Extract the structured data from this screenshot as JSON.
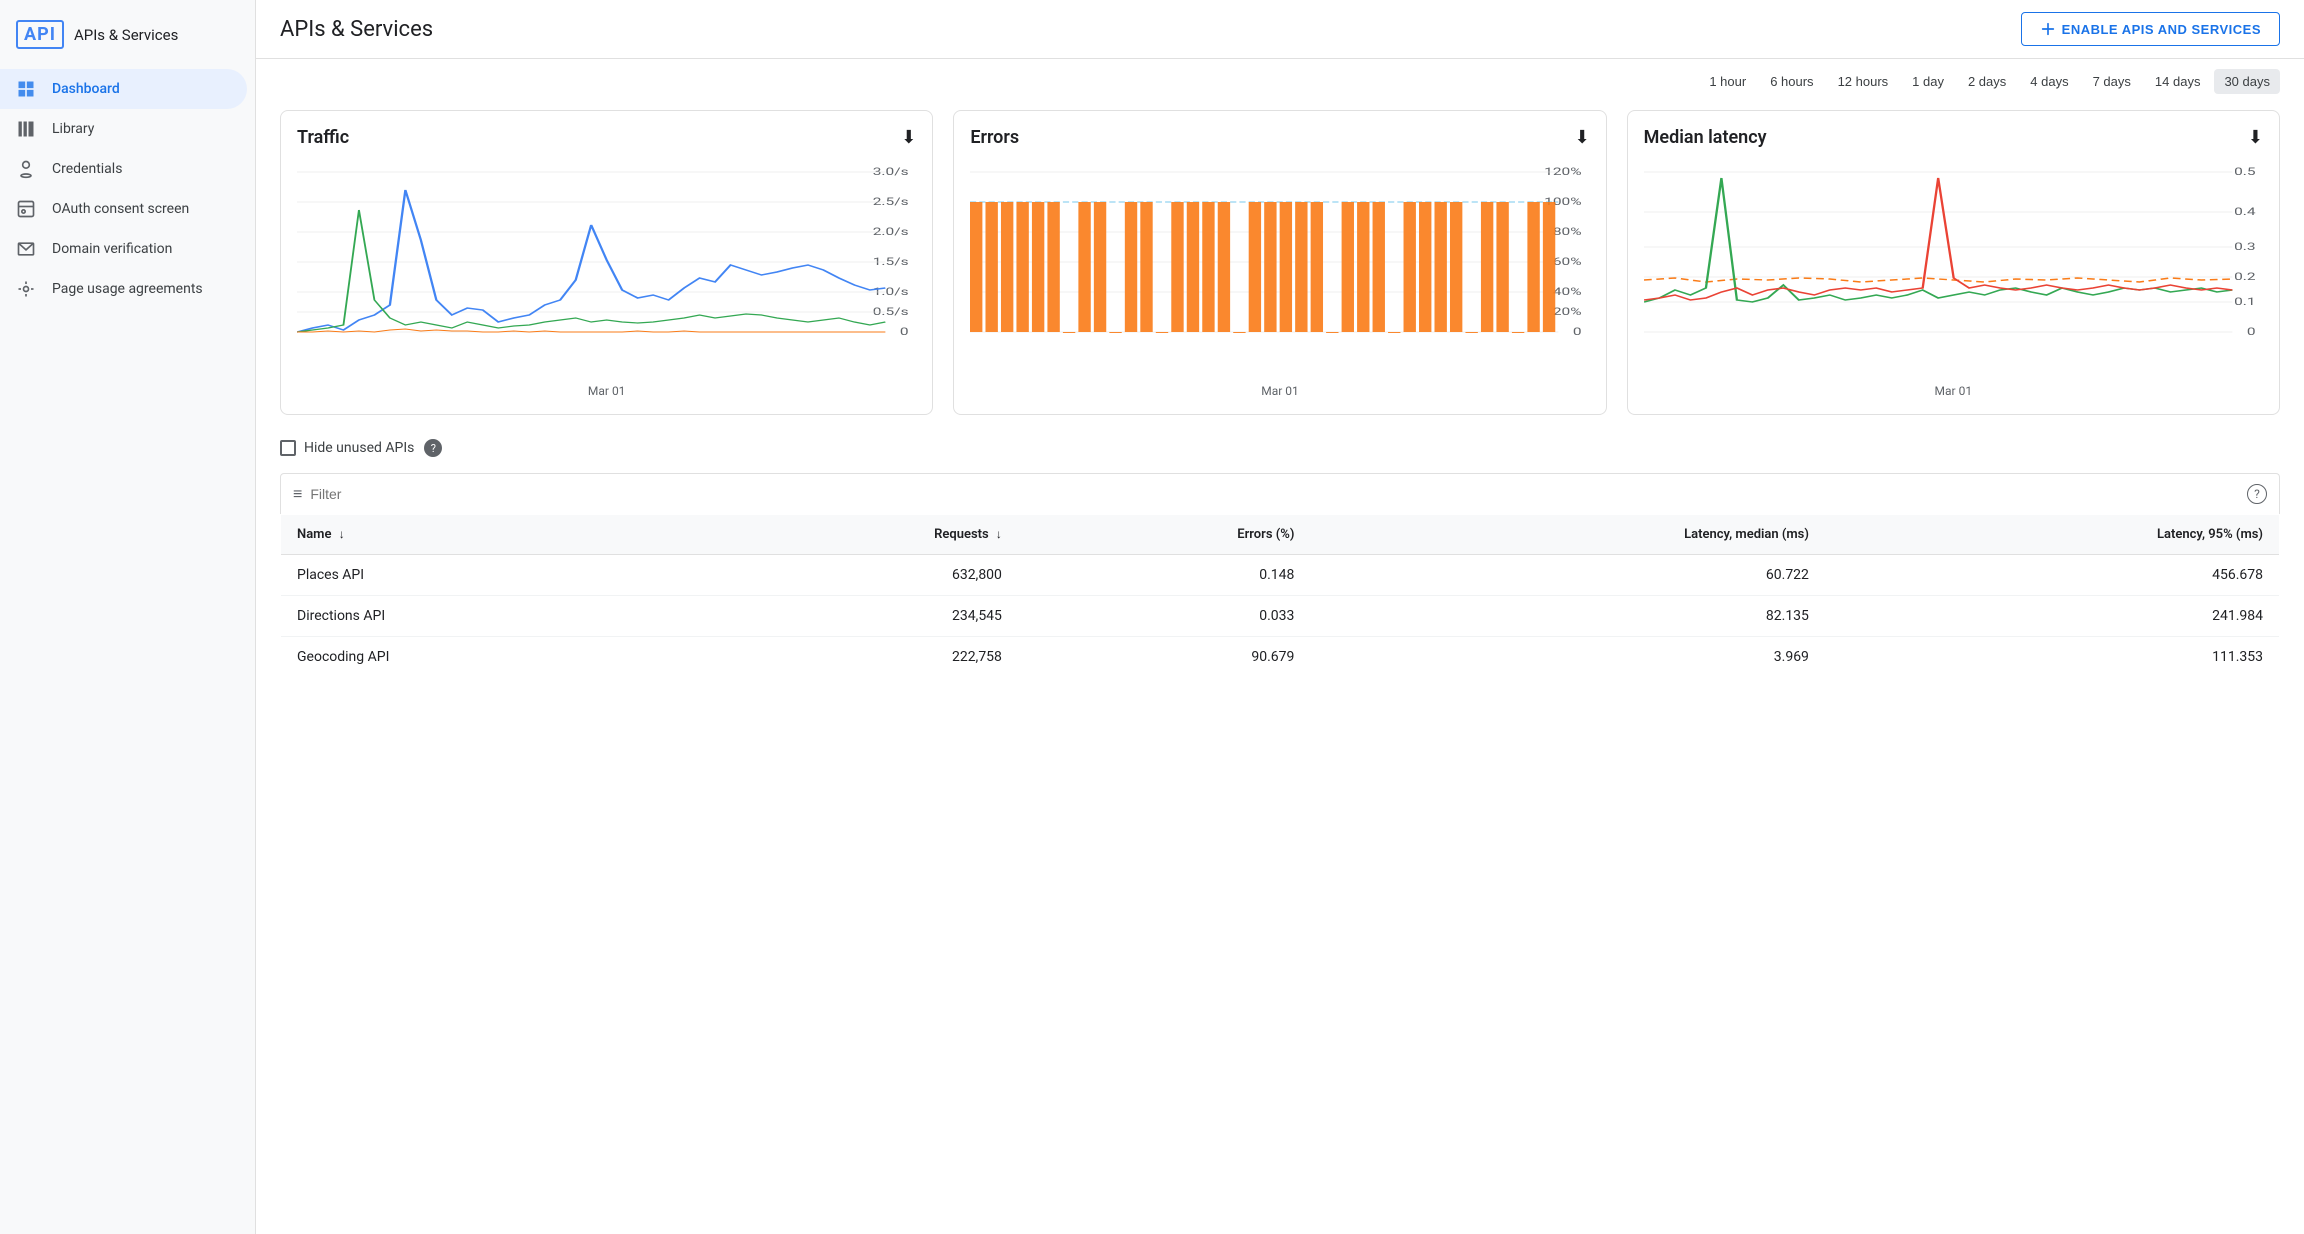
{
  "sidebar": {
    "logo_text": "API",
    "title": "APIs & Services",
    "items": [
      {
        "id": "dashboard",
        "label": "Dashboard",
        "active": true
      },
      {
        "id": "library",
        "label": "Library",
        "active": false
      },
      {
        "id": "credentials",
        "label": "Credentials",
        "active": false
      },
      {
        "id": "oauth",
        "label": "OAuth consent screen",
        "active": false
      },
      {
        "id": "domain",
        "label": "Domain verification",
        "active": false
      },
      {
        "id": "page-usage",
        "label": "Page usage agreements",
        "active": false
      }
    ]
  },
  "header": {
    "title": "APIs & Services",
    "enable_button": "ENABLE APIS AND SERVICES"
  },
  "time_range": {
    "options": [
      "1 hour",
      "6 hours",
      "12 hours",
      "1 day",
      "2 days",
      "4 days",
      "7 days",
      "14 days",
      "30 days"
    ],
    "active": "30 days"
  },
  "charts": {
    "traffic": {
      "title": "Traffic",
      "x_label": "Mar 01"
    },
    "errors": {
      "title": "Errors",
      "x_label": "Mar 01"
    },
    "latency": {
      "title": "Median latency",
      "x_label": "Mar 01"
    }
  },
  "filter": {
    "placeholder": "Filter",
    "hide_unused_label": "Hide unused APIs"
  },
  "table": {
    "columns": [
      {
        "id": "name",
        "label": "Name",
        "sortable": true,
        "sort_dir": "asc"
      },
      {
        "id": "requests",
        "label": "Requests",
        "sortable": true,
        "sort_dir": "desc"
      },
      {
        "id": "errors",
        "label": "Errors (%)",
        "sortable": false
      },
      {
        "id": "latency_median",
        "label": "Latency, median (ms)",
        "sortable": false
      },
      {
        "id": "latency_95",
        "label": "Latency, 95% (ms)",
        "sortable": false
      }
    ],
    "rows": [
      {
        "name": "Places API",
        "requests": "632,800",
        "errors": "0.148",
        "latency_median": "60.722",
        "latency_95": "456.678"
      },
      {
        "name": "Directions API",
        "requests": "234,545",
        "errors": "0.033",
        "latency_median": "82.135",
        "latency_95": "241.984"
      },
      {
        "name": "Geocoding API",
        "requests": "222,758",
        "errors": "90.679",
        "latency_median": "3.969",
        "latency_95": "111.353"
      }
    ]
  },
  "colors": {
    "primary_blue": "#1a73e8",
    "active_nav_bg": "#e8f0fe",
    "sidebar_bg": "#f8f9fa"
  }
}
